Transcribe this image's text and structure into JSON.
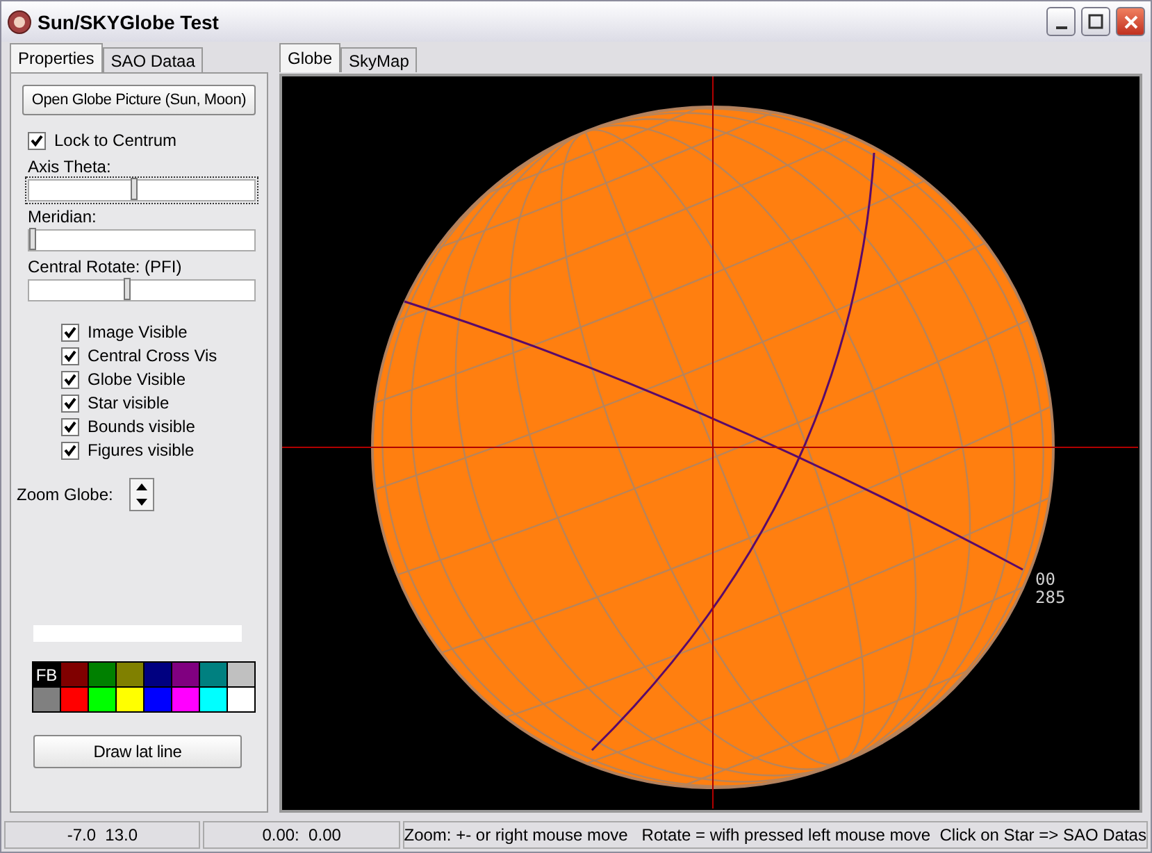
{
  "window": {
    "title": "Sun/SKYGlobe Test"
  },
  "left_tabs": [
    {
      "label": "Properties",
      "selected": true
    },
    {
      "label": "SAO Dataa",
      "selected": false
    }
  ],
  "open_button": "Open Globe Picture (Sun, Moon)",
  "lock": {
    "label": "Lock to Centrum",
    "checked": true
  },
  "sliders": [
    {
      "label": "Axis Theta:",
      "level": 0.47,
      "focused": true
    },
    {
      "label": "Meridian:",
      "level": 0.02,
      "focused": false
    },
    {
      "label": "Central Rotate: (PFI)",
      "level": 0.44,
      "focused": false
    }
  ],
  "visibility_options": [
    {
      "label": "Image Visible",
      "checked": true
    },
    {
      "label": "Central Cross Vis",
      "checked": true
    },
    {
      "label": "Globe Visible",
      "checked": true
    },
    {
      "label": "Star visible",
      "checked": true
    },
    {
      "label": "Bounds visible",
      "checked": true
    },
    {
      "label": "Figures visible",
      "checked": true
    }
  ],
  "zoom": {
    "label": "Zoom Globe:"
  },
  "palette": [
    {
      "color": "#000000",
      "label": "FB"
    },
    {
      "color": "#800000"
    },
    {
      "color": "#008000"
    },
    {
      "color": "#808000"
    },
    {
      "color": "#000080"
    },
    {
      "color": "#800080"
    },
    {
      "color": "#008080"
    },
    {
      "color": "#c0c0c0"
    },
    {
      "color": "#808080"
    },
    {
      "color": "#ff0000"
    },
    {
      "color": "#00ff00"
    },
    {
      "color": "#ffff00"
    },
    {
      "color": "#0000ff"
    },
    {
      "color": "#ff00ff"
    },
    {
      "color": "#00ffff"
    },
    {
      "color": "#ffffff"
    }
  ],
  "draw_button": "Draw lat line",
  "right_tabs": [
    {
      "label": "Globe",
      "selected": true
    },
    {
      "label": "SkyMap",
      "selected": false
    }
  ],
  "globe": {
    "labels": [
      "00",
      "285"
    ]
  },
  "status_bar": [
    "-7.0  13.0",
    "0.00:  0.00",
    "Zoom: +- or right mouse move   Rotate = wifh pressed left mouse move  Click on Star => SAO Datas"
  ]
}
